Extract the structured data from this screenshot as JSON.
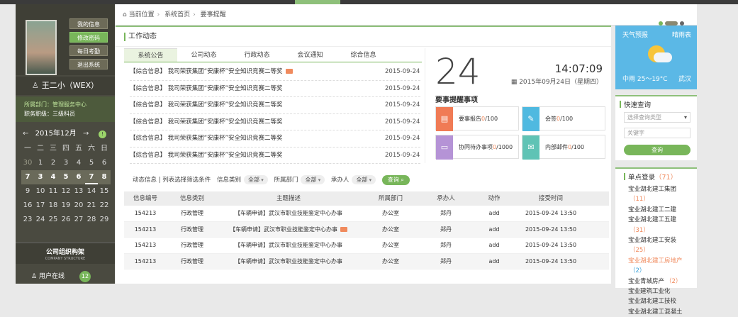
{
  "sidebar": {
    "buttons": [
      "我的信息",
      "修改密码",
      "每日考勤",
      "退出系统"
    ],
    "username": "王二小（WEX）",
    "dept_label": "所属部门：",
    "dept_value": "管理服务中心",
    "rank_label": "职务职级：",
    "rank_value": "三级科员",
    "calendar": {
      "prev": "←",
      "month": "2015年12月",
      "next": "→",
      "badge": "!",
      "weekdays": [
        "一",
        "二",
        "三",
        "四",
        "五",
        "六",
        "日"
      ],
      "days": [
        "30",
        "1",
        "2",
        "3",
        "4",
        "5",
        "6",
        "7",
        "3",
        "4",
        "5",
        "6",
        "7",
        "8",
        "9",
        "10",
        "11",
        "12",
        "13",
        "14",
        "15",
        "16",
        "17",
        "18",
        "19",
        "20",
        "21",
        "22",
        "23",
        "24",
        "25",
        "26",
        "27",
        "28",
        "29"
      ]
    },
    "org_title": "公司组织构架",
    "org_sub": "COMPANY STRUCTURE",
    "online_label": "用户在线",
    "online_count": "12"
  },
  "breadcrumb": {
    "items": [
      "当前位置",
      "系统首页",
      "要事提醒"
    ]
  },
  "work": {
    "title": "工作动态",
    "tabs": [
      "系统公告",
      "公司动态",
      "行政动态",
      "会议通知",
      "综合信息"
    ],
    "news": [
      {
        "title": "【综合信息】 我司荣获集团“安康杯”安全知识竞赛二等奖",
        "date": "2015-09-24"
      },
      {
        "title": "【综合信息】 我司荣获集团“安康杯”安全知识竞赛二等奖",
        "date": "2015-09-24"
      },
      {
        "title": "【综合信息】 我司荣获集团“安康杯”安全知识竞赛二等奖",
        "date": "2015-09-24"
      },
      {
        "title": "【综合信息】 我司荣获集团“安康杯”安全知识竞赛二等奖",
        "date": "2015-09-24"
      },
      {
        "title": "【综合信息】 我司荣获集团“安康杯”安全知识竞赛二等奖",
        "date": "2015-09-24"
      },
      {
        "title": "【综合信息】 我司荣获集团“安康杯”安全知识竞赛二等奖",
        "date": "2015-09-24"
      }
    ]
  },
  "alerts": {
    "day": "24",
    "time": "14:07:09",
    "date": "2015年09月24日（星期四）",
    "title": "要事提醒事项",
    "cards": [
      {
        "label": "要事报告",
        "count": "0",
        "total": "/100",
        "color": "#f07b55",
        "icon": "doc-icon"
      },
      {
        "label": "会签",
        "count": "0",
        "total": "/100",
        "color": "#4fb9e0",
        "icon": "edit-icon"
      },
      {
        "label": "协同待办事项",
        "count": "0",
        "total": "/1000",
        "color": "#b593d6",
        "icon": "message-icon"
      },
      {
        "label": "内部邮件",
        "count": "0",
        "total": "/100",
        "color": "#5fc3b5",
        "icon": "mail-icon"
      }
    ]
  },
  "filters": {
    "label": "动态信息 | 列表选择筛选条件",
    "type_label": "信息类别",
    "type_value": "全部",
    "dept_label": "所属部门",
    "dept_value": "全部",
    "owner_label": "承办人",
    "owner_value": "全部",
    "query": "查询"
  },
  "table": {
    "headers": [
      "信息编号",
      "信息类别",
      "主题描述",
      "所属部门",
      "承办人",
      "动作",
      "接受时间"
    ],
    "rows": [
      [
        "154213",
        "行政管理",
        "【车辆申请】武汉市职业技能鉴定中心办事",
        "办公室",
        "郑丹",
        "add",
        "2015-09-24  13:50"
      ],
      [
        "154213",
        "行政管理",
        "【车辆申请】武汉市职业技能鉴定中心办事",
        "办公室",
        "郑丹",
        "add",
        "2015-09-24  13:50"
      ],
      [
        "154213",
        "行政管理",
        "【车辆申请】武汉市职业技能鉴定中心办事",
        "办公室",
        "郑丹",
        "add",
        "2015-09-24  13:50"
      ],
      [
        "154213",
        "行政管理",
        "【车辆申请】武汉市职业技能鉴定中心办事",
        "办公室",
        "郑丹",
        "add",
        "2015-09-24  13:50"
      ]
    ]
  },
  "weather": {
    "title": "天气预报",
    "rainy": "晴雨表",
    "temp": "中雨 25～19°C",
    "city": "武汉"
  },
  "quick": {
    "title": "快速查询",
    "select_placeholder": "选择查询类型",
    "keyword_placeholder": "关键字",
    "button": "查询"
  },
  "sso": {
    "title": "单点登录",
    "count": "（71）",
    "items": [
      {
        "name": "宝业湖北建工集团",
        "count": "（11）"
      },
      {
        "name": "宝业湖北建工二建",
        "count": ""
      },
      {
        "name": "宝业湖北建工五建",
        "count": "（31）"
      },
      {
        "name": "宝业湖北建工安装",
        "count": "（25）"
      },
      {
        "name": "宝业湖北建工房地产",
        "count": "（2）"
      },
      {
        "name": "宝业青城房产",
        "count": "（2）"
      },
      {
        "name": "宝业建筑工业化",
        "count": ""
      },
      {
        "name": "宝业湖北建工技校",
        "count": ""
      },
      {
        "name": "宝业湖北建工混凝土",
        "count": ""
      }
    ]
  }
}
